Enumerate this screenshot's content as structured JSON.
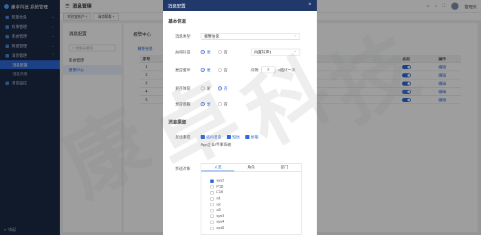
{
  "app": {
    "brand": "康卓科技 系统管理",
    "header_title": "消息管理",
    "user_name": "管理员"
  },
  "sidebar": {
    "items": [
      {
        "label": "配置信息",
        "expanded": false
      },
      {
        "label": "权限管理",
        "expanded": false
      },
      {
        "label": "系统管理",
        "expanded": false
      },
      {
        "label": "数据管理",
        "expanded": false
      },
      {
        "label": "消息管理",
        "expanded": true
      }
    ],
    "sub_items": [
      {
        "label": "消息配置",
        "active": true
      },
      {
        "label": "消息列表",
        "active": false
      }
    ],
    "extra_item": "消息监控",
    "collapse_label": "收起"
  },
  "tabs": [
    {
      "label": "实验室账户 ×",
      "active": false
    },
    {
      "label": "消息配置 ×",
      "active": true
    }
  ],
  "tree": {
    "title": "消息配置",
    "search_placeholder": "搜索关键词",
    "nodes": [
      "系统管理",
      "报警中心"
    ]
  },
  "content": {
    "title": "报警中心",
    "sub_tab": "报警信息",
    "table": {
      "headers": {
        "no": "序号",
        "enabled": "启用",
        "action": "操作"
      },
      "rows": [
        {
          "no": "1",
          "action": "编辑"
        },
        {
          "no": "2",
          "action": "编辑"
        },
        {
          "no": "3",
          "action": "编辑"
        },
        {
          "no": "4",
          "action": "编辑"
        },
        {
          "no": "5",
          "action": "编辑"
        }
      ]
    }
  },
  "modal": {
    "title": "消息配置",
    "section_basic": "基本信息",
    "msg_type_label": "消息类型",
    "msg_type_value": "报警信息",
    "sound_label": "启用铃音",
    "yes": "是",
    "no": "否",
    "sound_value": "内置铃声1",
    "loop_label": "是否循环",
    "interval_label": "间隔",
    "interval_value": "2",
    "interval_unit": "s循环一次",
    "popup_label": "是否弹窗",
    "remind_label": "是否提醒",
    "section_channel": "消息渠道",
    "channel_label": "发送渠道",
    "channels": [
      "站内消息",
      "短信",
      "邮箱"
    ],
    "app_label": "App企业/苹果系统",
    "target_label": "抄送对象",
    "target_tabs": [
      "人员",
      "角色",
      "部门"
    ],
    "users": [
      {
        "name": "sys2",
        "checked": true
      },
      {
        "name": "P18",
        "checked": false
      },
      {
        "name": "F18",
        "checked": false
      },
      {
        "name": "a1",
        "checked": false
      },
      {
        "name": "a2",
        "checked": false
      },
      {
        "name": "a3",
        "checked": false
      },
      {
        "name": "sys3",
        "checked": false
      },
      {
        "name": "sys4",
        "checked": false
      },
      {
        "name": "sys5",
        "checked": false
      }
    ]
  },
  "watermark": [
    "康",
    "卓",
    "科",
    "技"
  ]
}
